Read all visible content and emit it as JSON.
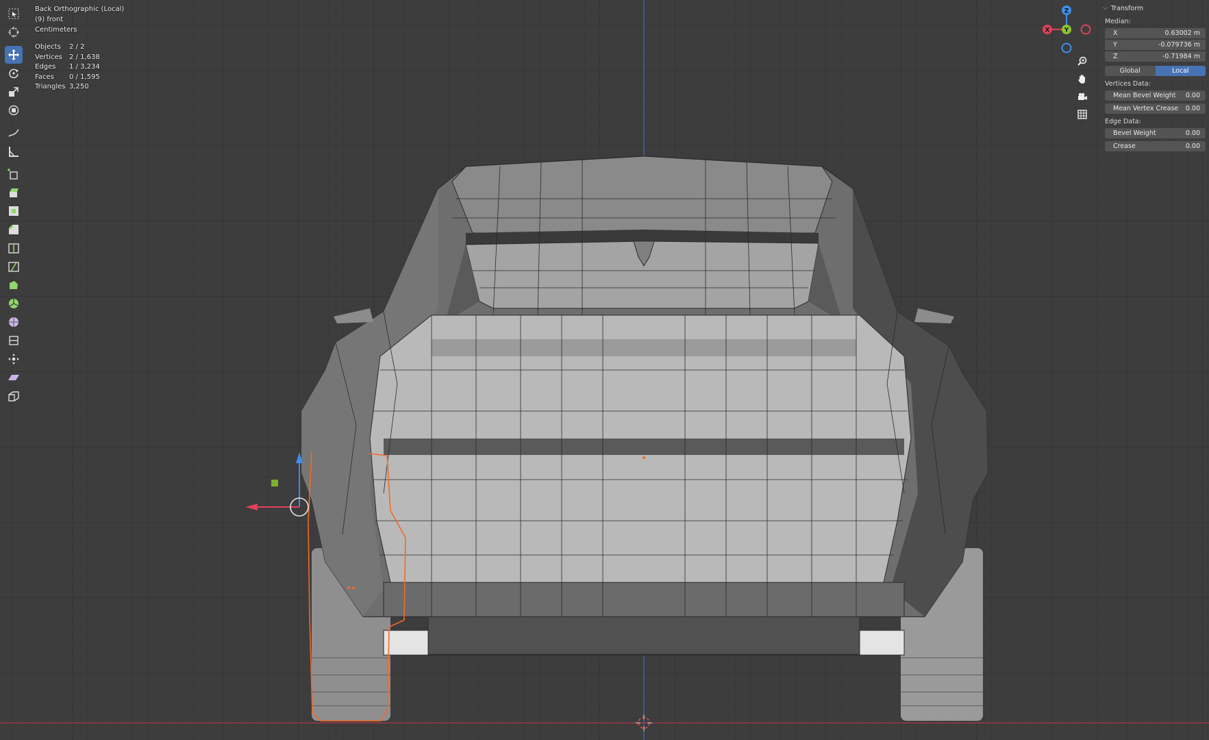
{
  "viewport": {
    "view_name": "Back Orthographic (Local)",
    "collection": "(9) front",
    "units": "Centimeters"
  },
  "stats": [
    {
      "label": "Objects",
      "value": "2 / 2"
    },
    {
      "label": "Vertices",
      "value": "2 / 1,638"
    },
    {
      "label": "Edges",
      "value": "1 / 3,234"
    },
    {
      "label": "Faces",
      "value": "0 / 1,595"
    },
    {
      "label": "Triangles",
      "value": "3,250"
    }
  ],
  "gizmo": {
    "x_label": "X",
    "y_label": "Y",
    "z_label": "Z"
  },
  "toolbar": {
    "tools": [
      {
        "name": "select-box-icon",
        "active": false
      },
      {
        "name": "cursor-icon",
        "active": false
      },
      {
        "name": "move-icon",
        "active": true
      },
      {
        "name": "rotate-icon",
        "active": false
      },
      {
        "name": "scale-icon",
        "active": false
      },
      {
        "name": "transform-icon",
        "active": false
      },
      {
        "name": "annotate-icon",
        "active": false
      },
      {
        "name": "measure-icon",
        "active": false
      },
      {
        "name": "add-cube-icon",
        "active": false
      },
      {
        "name": "extrude-icon",
        "active": false
      },
      {
        "name": "inset-icon",
        "active": false
      },
      {
        "name": "bevel-icon",
        "active": false
      },
      {
        "name": "loop-cut-icon",
        "active": false
      },
      {
        "name": "knife-icon",
        "active": false
      },
      {
        "name": "poly-build-icon",
        "active": false
      },
      {
        "name": "spin-icon",
        "active": false
      },
      {
        "name": "smooth-icon",
        "active": false
      },
      {
        "name": "edge-slide-icon",
        "active": false
      },
      {
        "name": "shrink-fatten-icon",
        "active": false
      },
      {
        "name": "shear-icon",
        "active": false
      },
      {
        "name": "rip-icon",
        "active": false
      }
    ]
  },
  "panel": {
    "header": "Transform",
    "median_label": "Median:",
    "x": {
      "label": "X",
      "value": "0.63002 m"
    },
    "y": {
      "label": "Y",
      "value": "-0.079736 m"
    },
    "z": {
      "label": "Z",
      "value": "-0.71984 m"
    },
    "space_global": "Global",
    "space_local": "Local",
    "vertices_data_label": "Vertices Data:",
    "mean_bevel_weight": {
      "label": "Mean Bevel Weight",
      "value": "0.00"
    },
    "mean_vertex_crease": {
      "label": "Mean Vertex Crease",
      "value": "0.00"
    },
    "edge_data_label": "Edge Data:",
    "bevel_weight": {
      "label": "Bevel Weight",
      "value": "0.00"
    },
    "crease": {
      "label": "Crease",
      "value": "0.00"
    }
  },
  "colors": {
    "accent": "#4772b3",
    "axis_x": "#e2405a",
    "axis_y": "#8bc431",
    "axis_z": "#3f8fe8",
    "selection": "#f3692a"
  }
}
